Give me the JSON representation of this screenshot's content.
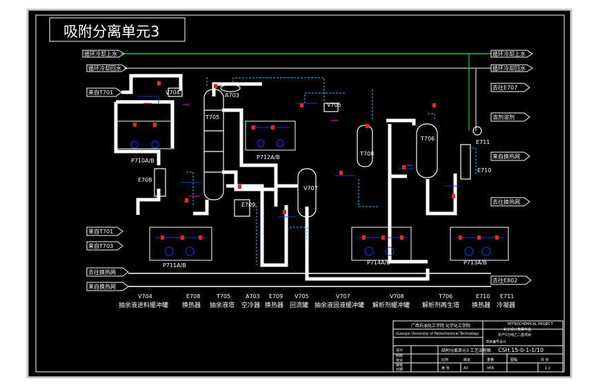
{
  "title": "吸附分离单元3",
  "colors": {
    "background": "#000000",
    "outer": "#c8c8c8",
    "line": "#ffffff",
    "pipe": "#ffffff",
    "water": "#00ff00",
    "dashed": "#00c8ff",
    "valve": "#ff2020",
    "equip": "#0040ff",
    "magenta": "#ff00ff",
    "yellow": "#ffff00"
  },
  "streams": {
    "cw_supply_left": "循环冷却上水",
    "cw_return_left": "循环冷却回水",
    "cw_supply_right": "循环冷却上水",
    "cw_return_right": "循环冷却回水",
    "from_t701": "来自T701",
    "to_e707": "去往E707",
    "solvent": "溶剂溶剂",
    "from_exchanger_1": "来自换热网",
    "to_exchanger": "去往换热网",
    "from_t701_b": "来自T701",
    "from_t703": "来自T703",
    "to_exchanger_left": "去往换热网",
    "from_exchanger_left": "来自换热网",
    "to_e802": "去往E802"
  },
  "equipment_tags": {
    "v704_a": "V704",
    "t705": "T705",
    "a703": "A703",
    "v705": "V705",
    "t708": "T708",
    "v707": "V707",
    "t706": "T706",
    "e711": "E711",
    "e710": "E710",
    "e708": "E708",
    "e709": "E709",
    "p710": "P710A/B",
    "p712": "P712A/B",
    "p711": "P711A/B",
    "p714": "P714A/B",
    "p713": "P713A/B"
  },
  "legend": [
    {
      "tag": "V704",
      "name": "抽余液进料缓冲罐"
    },
    {
      "tag": "E708",
      "name": "换热器"
    },
    {
      "tag": "T705",
      "name": "抽余液塔"
    },
    {
      "tag": "A703",
      "name": "空冷器"
    },
    {
      "tag": "E709",
      "name": "换热器"
    },
    {
      "tag": "V705",
      "name": "回流罐"
    },
    {
      "tag": "V707",
      "name": "抽余液固液缓冲罐"
    },
    {
      "tag": "V708",
      "name": "解析剂缓冲罐"
    },
    {
      "tag": "T706",
      "name": "解析剂再生塔"
    },
    {
      "tag": "E710",
      "name": "换热器"
    },
    {
      "tag": "E711",
      "name": "冷凝器"
    }
  ],
  "title_block": {
    "school": "广西石油化工学院  化学化工学院",
    "school_en": "Guangxi University of Petrochemical Technology",
    "project_lines": [
      "PETROCHEMICAL PROJECT",
      "化工设计竞赛作品",
      "年产5万吨乙二醇项目",
      "项目编号设计"
    ],
    "drawing_name": "吸附分离单元3 工艺流程图",
    "drawing_no": "CSH.15-0-1-1/10",
    "left_rows": [
      "设计",
      "制图",
      "校对",
      "审核",
      "日期"
    ],
    "small_cells": [
      "比例",
      "版本",
      "重量",
      "图幅",
      "共 张",
      "第 张",
      "A3",
      "VER",
      "1:1"
    ]
  }
}
